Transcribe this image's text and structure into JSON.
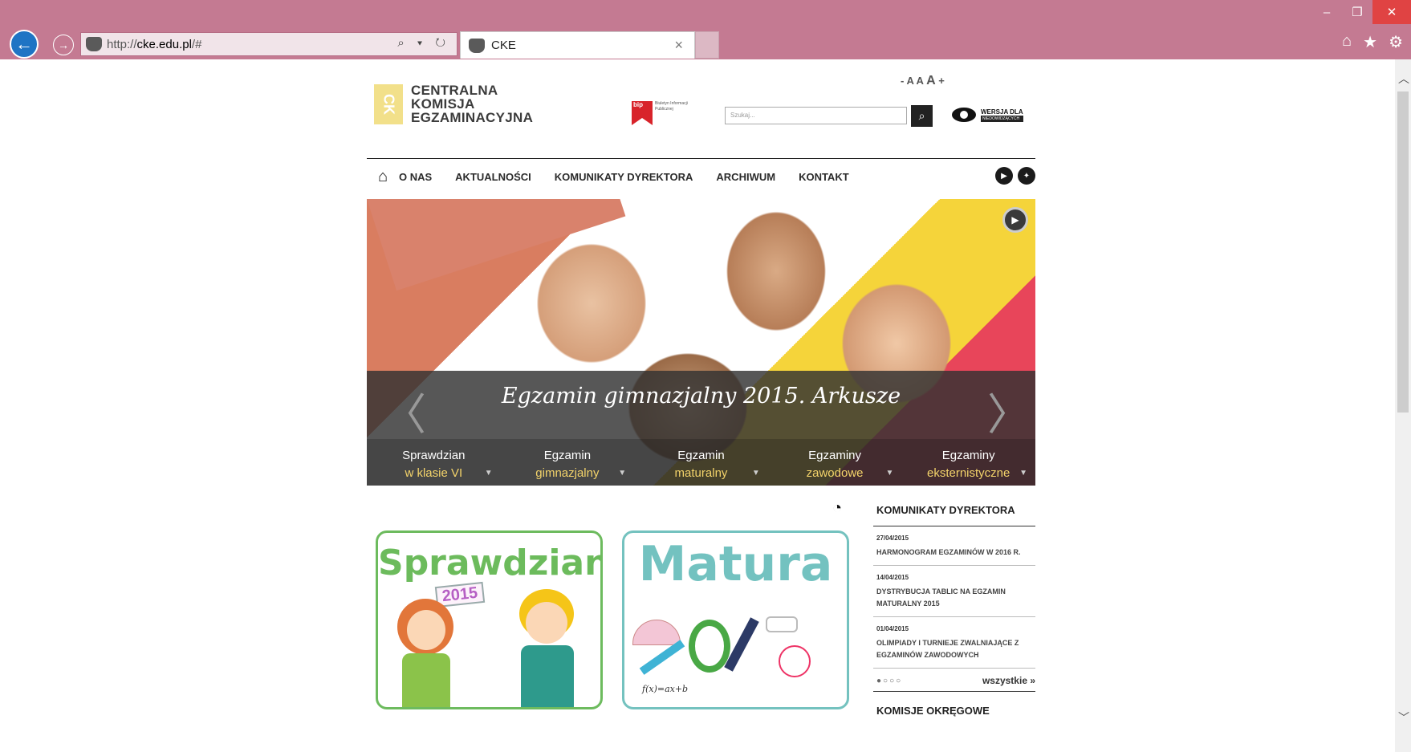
{
  "browser": {
    "url_prefix": "http://",
    "url_host": "cke.edu.pl",
    "url_suffix": "/#",
    "tab_title": "CKE",
    "addr_tools": "⌕ ▾ ↻",
    "tab_close": "×"
  },
  "site": {
    "logo_mark": "CK",
    "logo_line1": "CENTRALNA",
    "logo_line2": "KOMISJA",
    "logo_line3": "EGZAMINACYJNA",
    "font_controls": {
      "minus": "-",
      "small": "A",
      "mid": "A",
      "big": "A",
      "plus": "+"
    },
    "bip_label": "bip",
    "bip_text": "Biuletyn Informacji Publicznej",
    "search_placeholder": "Szukaj...",
    "wersja_line1": "WERSJA DLA",
    "wersja_line2": "NIEDOWIDZĄCYCH"
  },
  "nav": {
    "items": [
      "O NAS",
      "AKTUALNOŚCI",
      "KOMUNIKATY DYREKTORA",
      "ARCHIWUM",
      "KONTAKT"
    ]
  },
  "hero": {
    "title": "Egzamin gimnazjalny 2015. Arkusze",
    "tabs": [
      {
        "line1": "Sprawdzian",
        "line2": "w klasie VI"
      },
      {
        "line1": "Egzamin",
        "line2": "gimnazjalny"
      },
      {
        "line1": "Egzamin",
        "line2": "maturalny"
      },
      {
        "line1": "Egzaminy",
        "line2": "zawodowe"
      },
      {
        "line1": "Egzaminy",
        "line2": "eksternistyczne"
      }
    ]
  },
  "sidebar": {
    "heading": "KOMUNIKATY DYREKTORA",
    "news": [
      {
        "date": "27/04/2015",
        "title": "HARMONOGRAM EGZAMINÓW W 2016 R."
      },
      {
        "date": "14/04/2015",
        "title": "DYSTRYBUCJA TABLIC NA EGZAMIN MATURALNY 2015"
      },
      {
        "date": "01/04/2015",
        "title": "OLIMPIADY I TURNIEJE ZWALNIAJĄCE Z EGZAMINÓW ZAWODOWYCH"
      }
    ],
    "dots": "●○○○",
    "all_link": "wszystkie »",
    "heading2": "KOMISJE OKRĘGOWE"
  },
  "cards": {
    "sprawdzian": "Sprawdzian",
    "sprawdzian_year": "2015",
    "matura": "Matura",
    "matura_formula": "f(x)=ax+b"
  },
  "colors": {
    "chrome": "#c47a92",
    "accent_yellow": "#f3d36a",
    "sprawdzian_green": "#6cbb5c",
    "matura_teal": "#73c2c0"
  }
}
